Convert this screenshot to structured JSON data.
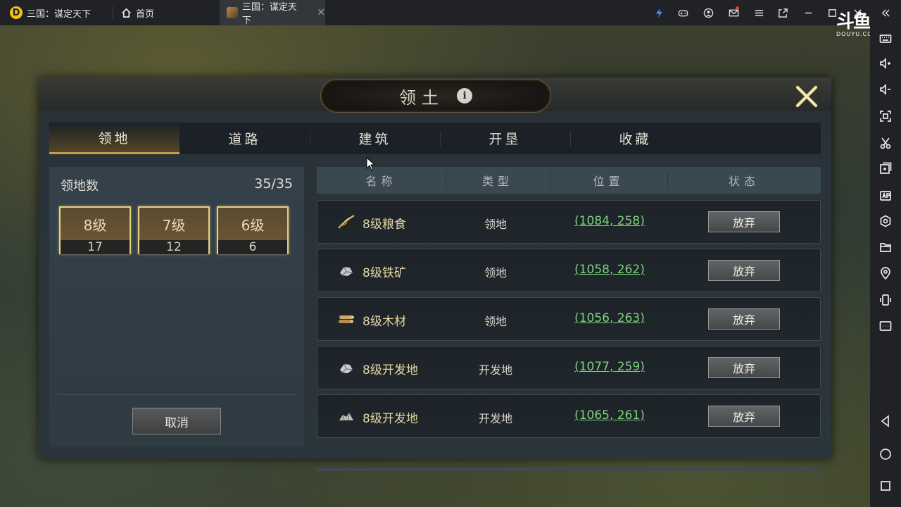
{
  "emulator": {
    "tabs": [
      {
        "label": "三国：谋定天下",
        "icon": "app-logo-icon"
      },
      {
        "label": "首页",
        "icon": "home-icon"
      },
      {
        "label": "三国：谋定天下",
        "icon": "game-thumb-icon",
        "active": true
      }
    ],
    "logo_letter": "D",
    "watermark": {
      "big": "斗鱼",
      "small": "DOUYU.COM"
    }
  },
  "panel": {
    "title": "领土",
    "info_glyph": "i",
    "tabs": [
      "领地",
      "道路",
      "建筑",
      "开垦",
      "收藏"
    ],
    "active_tab": 0
  },
  "summary": {
    "label": "领地数",
    "value": "35/35",
    "levels": [
      {
        "level": "8级",
        "count": "17"
      },
      {
        "level": "7级",
        "count": "12"
      },
      {
        "level": "6级",
        "count": "6"
      }
    ],
    "cancel_label": "取消"
  },
  "table": {
    "headers": [
      "名称",
      "类型",
      "位置",
      "状态"
    ],
    "rows": [
      {
        "name": "8级粮食",
        "type": "领地",
        "pos": "(1084, 258)",
        "action": "放弃",
        "icon": "grain-icon"
      },
      {
        "name": "8级铁矿",
        "type": "领地",
        "pos": "(1058, 262)",
        "action": "放弃",
        "icon": "iron-ore-icon"
      },
      {
        "name": "8级木材",
        "type": "领地",
        "pos": "(1056, 263)",
        "action": "放弃",
        "icon": "wood-icon"
      },
      {
        "name": "8级开发地",
        "type": "开发地",
        "pos": "(1077, 259)",
        "action": "放弃",
        "icon": "development-land-icon"
      },
      {
        "name": "8级开发地",
        "type": "开发地",
        "pos": "(1065, 261)",
        "action": "放弃",
        "icon": "development-land-icon"
      }
    ]
  },
  "colors": {
    "gold_border": "#e8cf82",
    "coordinate_green": "#7fd07e",
    "name_gold": "#e6d5a4"
  }
}
